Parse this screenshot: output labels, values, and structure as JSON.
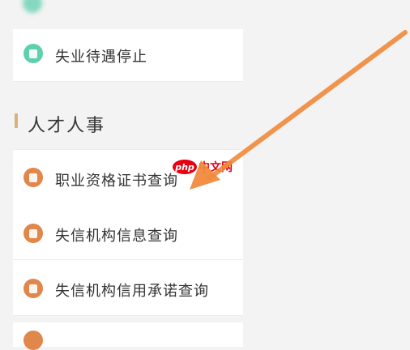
{
  "top_item": {
    "label": "",
    "icon": "partial-green-icon"
  },
  "items_top": [
    {
      "label": "失业待遇停止",
      "icon": "document-icon",
      "color": "#5fcfae"
    }
  ],
  "section": {
    "title": "人才人事"
  },
  "items_talent": [
    {
      "label": "职业资格证书查询",
      "icon": "certificate-icon",
      "color": "#e0874b"
    },
    {
      "label": "失信机构信息查询",
      "icon": "document-icon",
      "color": "#e0874b"
    },
    {
      "label": "失信机构信用承诺查询",
      "icon": "document-icon",
      "color": "#e0874b"
    }
  ],
  "watermark": {
    "badge": "php",
    "text": "中文网"
  },
  "colors": {
    "accent_green": "#5fcfae",
    "accent_orange": "#e0874b",
    "arrow": "#f08a3c",
    "section_bar": "#d9b27a"
  }
}
